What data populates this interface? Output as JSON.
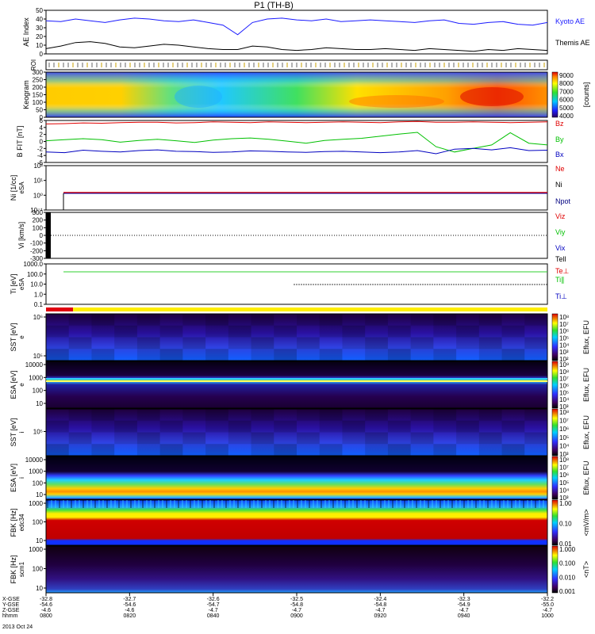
{
  "title": "P1 (TH-B)",
  "date_label": "2013 Oct 24",
  "chart_data": {
    "type": "multi-panel",
    "panels": [
      {
        "id": "ae",
        "type": "line",
        "ylabel": "AE Index",
        "yticks": [
          "50",
          "40",
          "30",
          "20",
          "10",
          "0"
        ],
        "series": [
          {
            "name": "Kyoto AE",
            "color": "#1a1aff",
            "values": [
              38,
              37,
              40,
              38,
              36,
              39,
              41,
              40,
              38,
              37,
              39,
              36,
              33,
              22,
              36,
              40,
              41,
              39,
              38,
              40,
              37,
              38,
              39,
              38,
              37,
              36,
              38,
              39,
              35,
              34,
              36,
              37,
              34,
              33,
              36
            ]
          },
          {
            "name": "Themis AE",
            "color": "#000000",
            "values": [
              6,
              9,
              13,
              14,
              12,
              8,
              7,
              9,
              11,
              10,
              8,
              6,
              5,
              5,
              9,
              8,
              5,
              4,
              5,
              7,
              6,
              5,
              5,
              6,
              5,
              4,
              6,
              5,
              4,
              3,
              5,
              4,
              6,
              5,
              4
            ]
          }
        ]
      },
      {
        "id": "roi",
        "type": "tickstrip",
        "ylabel": "ROI"
      },
      {
        "id": "keogram",
        "type": "heatmap",
        "ylabel": "Keogram",
        "yticks": [
          "300",
          "250",
          "200",
          "150",
          "100",
          "50",
          "0"
        ],
        "colorbar": [
          "9000",
          "8000",
          "7000",
          "6000",
          "5000",
          "4000"
        ],
        "colorbar_label": "[counts]"
      },
      {
        "id": "bfield",
        "type": "line",
        "ylabel": "B FIT [nT]",
        "yticks": [
          "6",
          "4",
          "2",
          "0",
          "-2",
          "-4",
          "-6"
        ],
        "series": [
          {
            "name": "Bz",
            "color": "#e00000",
            "values": [
              5.0,
              5.1,
              5.3,
              5.2,
              5.4,
              5.5,
              5.5,
              5.3,
              5.4,
              5.6,
              5.5,
              5.4,
              5.6,
              5.5,
              5.4,
              5.5,
              5.6,
              5.5,
              5.4,
              5.6,
              5.7,
              5.5,
              5.5,
              5.6,
              5.5,
              5.4,
              5.5,
              5.6
            ]
          },
          {
            "name": "By",
            "color": "#00c000",
            "values": [
              0.2,
              0.5,
              0.8,
              0.5,
              -0.2,
              0.3,
              0.6,
              0.2,
              -0.3,
              0.4,
              0.8,
              1.0,
              0.6,
              0.1,
              -0.5,
              0.3,
              0.6,
              0.9,
              1.5,
              2.1,
              2.6,
              -1.5,
              -3.0,
              -2.0,
              -1.0,
              2.5,
              -0.5,
              -1.0
            ]
          },
          {
            "name": "Bx",
            "color": "#0000c0",
            "values": [
              -3.0,
              -3.2,
              -2.5,
              -2.8,
              -3.0,
              -2.6,
              -2.4,
              -2.8,
              -2.9,
              -3.1,
              -3.0,
              -2.7,
              -2.8,
              -3.0,
              -3.1,
              -2.9,
              -2.8,
              -3.0,
              -3.2,
              -3.0,
              -2.6,
              -3.5,
              -2.2,
              -2.0,
              -2.4,
              -1.8,
              -2.6,
              -2.5
            ]
          }
        ]
      },
      {
        "id": "density",
        "type": "line",
        "ylabel": "Ni [1/cc]",
        "units": "eSA",
        "yticks": [
          "10²",
          "10¹",
          "10⁰",
          "10⁻¹"
        ],
        "series": [
          {
            "name": "Ne",
            "color": "#e00000"
          },
          {
            "name": "Ni",
            "color": "#000000"
          },
          {
            "name": "Npot",
            "color": "#000080"
          }
        ]
      },
      {
        "id": "velocity",
        "type": "line",
        "ylabel": "Vi [km/s]",
        "yticks": [
          "300",
          "200",
          "100",
          "0",
          "-100",
          "-200",
          "-300"
        ],
        "series": [
          {
            "name": "Viz",
            "color": "#e00000"
          },
          {
            "name": "Viy",
            "color": "#00c000"
          },
          {
            "name": "Vix",
            "color": "#0000c0"
          },
          {
            "name": "Tell",
            "color": "#000000"
          }
        ]
      },
      {
        "id": "temperature",
        "type": "line",
        "ylabel": "Ti [eV]",
        "units": "eSA",
        "yticks": [
          "1000.0",
          "100.0",
          "10.0",
          "1.0",
          "0.1"
        ],
        "series": [
          {
            "name": "Te⊥",
            "color": "#e00000"
          },
          {
            "name": "Ti∥",
            "color": "#00c000"
          },
          {
            "name": "Ti⊥",
            "color": "#0000c0"
          }
        ]
      },
      {
        "id": "mode",
        "type": "bar-strip"
      },
      {
        "id": "sst_e",
        "type": "spectrogram",
        "ylabel": "SST [eV]",
        "units": "e",
        "yticks": [
          "10⁶",
          "10⁵"
        ],
        "colorbar_label": "Eflux, EFU",
        "colorbar": [
          "10⁸",
          "10⁷",
          "10⁶",
          "10⁵",
          "10⁴",
          "10³",
          "10²"
        ]
      },
      {
        "id": "esa_e",
        "type": "spectrogram",
        "ylabel": "ESA [eV]",
        "units": "e",
        "yticks": [
          "10000",
          "1000",
          "100",
          "10"
        ],
        "colorbar_label": "Eflux, EFU",
        "colorbar": [
          "10⁹",
          "10⁸",
          "10⁷",
          "10⁶",
          "10⁵",
          "10⁴",
          "10³"
        ]
      },
      {
        "id": "sst_i",
        "type": "spectrogram",
        "ylabel": "SST [eV]",
        "units": "i",
        "yticks": [
          "10⁵"
        ],
        "colorbar_label": "Eflux, EFU",
        "colorbar": [
          "10⁸",
          "10⁷",
          "10⁶",
          "10⁵",
          "10⁴",
          "10³"
        ]
      },
      {
        "id": "esa_i",
        "type": "spectrogram",
        "ylabel": "ESA [eV]",
        "units": "i",
        "yticks": [
          "10000",
          "1000",
          "100",
          "10"
        ],
        "colorbar_label": "Eflux, EFU",
        "colorbar": [
          "10⁸",
          "10⁷",
          "10⁶",
          "10⁵",
          "10⁴",
          "10³"
        ]
      },
      {
        "id": "fbk1",
        "type": "spectrogram",
        "ylabel": "FBK [Hz]",
        "units": "edc34",
        "yticks": [
          "1000",
          "100",
          "10"
        ],
        "colorbar_label": "<mV/m>",
        "colorbar": [
          "1.00",
          "0.10",
          "0.01"
        ]
      },
      {
        "id": "fbk2",
        "type": "spectrogram",
        "ylabel": "FBK [Hz]",
        "units": "scm1",
        "yticks": [
          "1000",
          "100",
          "10"
        ],
        "colorbar_label": "<nT>",
        "colorbar": [
          "1.000",
          "0.100",
          "0.010",
          "0.001"
        ]
      }
    ],
    "x_axis": {
      "row_labels": [
        "X-GSE",
        "Y-GSE",
        "Z-GSE",
        "hhmm"
      ],
      "columns": [
        {
          "x": "-32.8",
          "y": "-54.6",
          "z": "-4.6",
          "t": "0800"
        },
        {
          "x": "-32.7",
          "y": "-54.6",
          "z": "-4.6",
          "t": "0820"
        },
        {
          "x": "-32.6",
          "y": "-54.7",
          "z": "-4.7",
          "t": "0840"
        },
        {
          "x": "-32.5",
          "y": "-54.8",
          "z": "-4.7",
          "t": "0900"
        },
        {
          "x": "-32.4",
          "y": "-54.8",
          "z": "-4.7",
          "t": "0920"
        },
        {
          "x": "-32.3",
          "y": "-54.9",
          "z": "-4.7",
          "t": "0940"
        },
        {
          "x": "-32.2",
          "y": "-55.0",
          "z": "-4.7",
          "t": "1000"
        }
      ]
    }
  }
}
